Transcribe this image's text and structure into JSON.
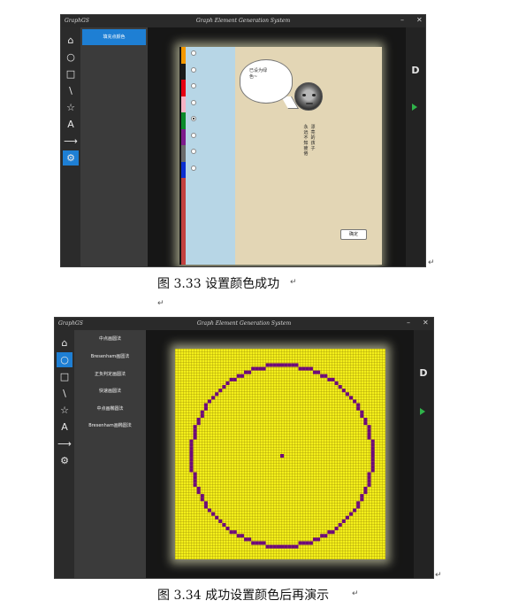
{
  "figure1": {
    "caption": "图 3.33 设置颜色成功",
    "window": {
      "app_label": "GraphGS",
      "title": "Graph Element Generation System",
      "minimize": "–",
      "close": "✕",
      "tools": [
        "home-icon",
        "circle-icon",
        "square-icon",
        "line-icon",
        "star-icon",
        "text-icon",
        "arrow-icon",
        "gear-icon"
      ],
      "tool_glyphs": [
        "⌂",
        "○",
        "□",
        "\\",
        "☆",
        "A",
        "⟶",
        "⚙"
      ],
      "active_tool": 7,
      "panel_button": "填充点颜色",
      "right_letter": "D",
      "color_options": [
        {
          "color": "#f39800",
          "selected": false
        },
        {
          "color": "#1a1a1a",
          "selected": false
        },
        {
          "color": "#e60012",
          "selected": false
        },
        {
          "color": "#f5b3c4",
          "selected": false
        },
        {
          "color": "#0a8a2a",
          "selected": true
        },
        {
          "color": "#7d1b8c",
          "selected": false
        },
        {
          "color": "#6b6b6b",
          "selected": false
        },
        {
          "color": "#0b2fd1",
          "selected": false
        }
      ],
      "bubble_text_line1": "已设为绿",
      "bubble_text_line2": "色~",
      "poem_col1": "漂亮的孩子",
      "poem_col2": "永远不知疲倦",
      "confirm_button": "确定"
    }
  },
  "figure2": {
    "caption": "图 3.34 成功设置颜色后再演示",
    "window": {
      "app_label": "GraphGS",
      "title": "Graph Element Generation System",
      "minimize": "–",
      "close": "✕",
      "tools": [
        "home-icon",
        "circle-icon",
        "square-icon",
        "line-icon",
        "star-icon",
        "text-icon",
        "arrow-icon",
        "gear-icon"
      ],
      "tool_glyphs": [
        "⌂",
        "○",
        "□",
        "\\",
        "☆",
        "A",
        "⟶",
        "⚙"
      ],
      "active_tool": 1,
      "algorithms": [
        "中点画圆法",
        "Bresenham画圆法",
        "正负判定画圆法",
        "快速画圆法",
        "中点画椭圆法",
        "Bresenham画椭圆法"
      ],
      "right_letter": "D",
      "pixel_color": "#6e0a7a",
      "background_color": "#f3ef1a"
    }
  },
  "paragraph_mark": "↵"
}
